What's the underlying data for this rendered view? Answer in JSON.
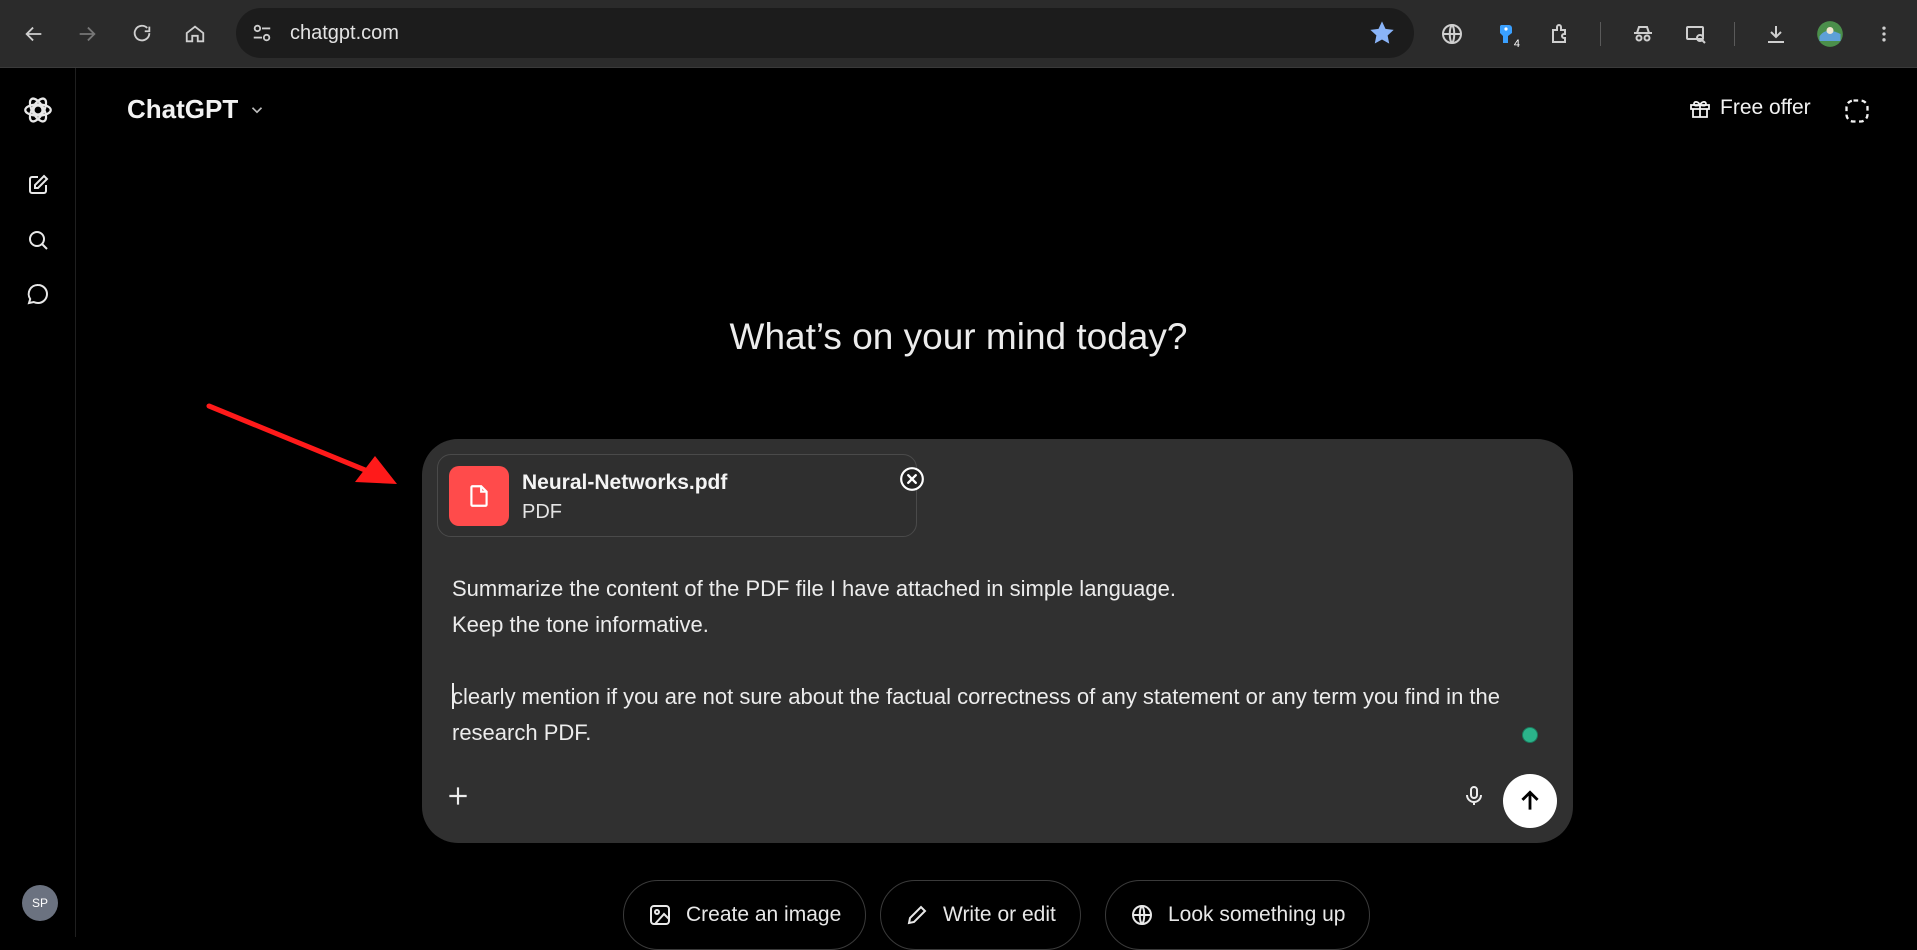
{
  "browser": {
    "url": "chatgpt.com",
    "extension_badge": "4"
  },
  "header": {
    "title": "ChatGPT",
    "free_offer_label": "Free offer"
  },
  "sidebar": {
    "avatar_initials": "SP"
  },
  "main": {
    "headline": "What’s on your mind today?"
  },
  "composer": {
    "attachment": {
      "file_name": "Neural-Networks.pdf",
      "file_type": "PDF"
    },
    "text": {
      "line1": "Summarize the content of the PDF file I have attached in simple language.",
      "line2": "Keep the tone informative.",
      "line3": "clearly mention if you are not sure about the factual correctness of any statement or any term you find in the research PDF."
    }
  },
  "suggestions": [
    {
      "label": "Create an image"
    },
    {
      "label": "Write or edit"
    },
    {
      "label": "Look something up"
    }
  ],
  "colors": {
    "pdf_icon_bg": "#ff4b4b",
    "annotation_arrow": "#ff1a1a",
    "status_dot": "#2bb38a"
  }
}
